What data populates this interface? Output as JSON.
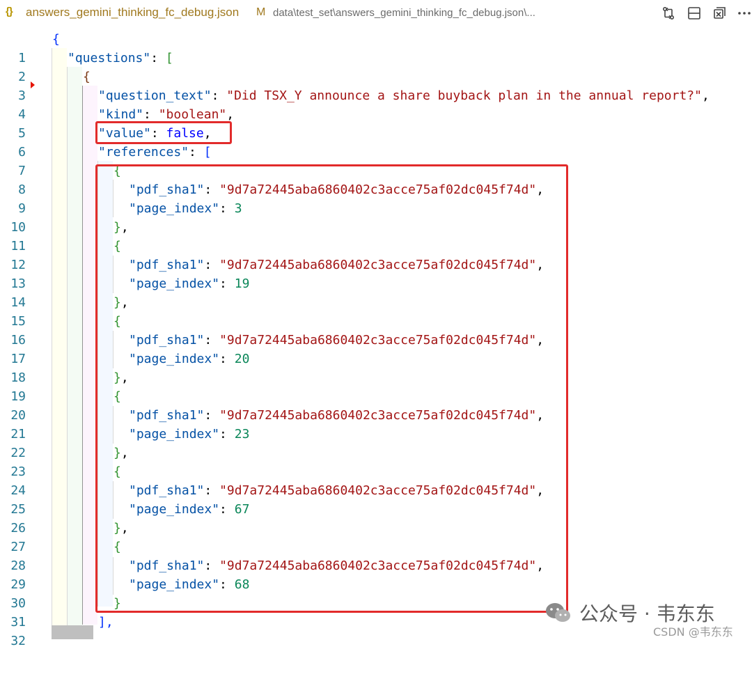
{
  "tab": {
    "icon_text": "{}",
    "file_name": "answers_gemini_thinking_fc_debug.json",
    "modified_flag": "M",
    "path": "data\\test_set\\answers_gemini_thinking_fc_debug.json\\..."
  },
  "toolbar": {
    "icons": [
      "source-control-compare-icon",
      "split-editor-icon",
      "collapse-all-icon",
      "more-actions-icon"
    ],
    "more_label": "···"
  },
  "editor": {
    "line_numbers": [
      "1",
      "2",
      "3",
      "4",
      "5",
      "6",
      "7",
      "8",
      "9",
      "10",
      "11",
      "12",
      "13",
      "14",
      "15",
      "16",
      "17",
      "18",
      "19",
      "20",
      "21",
      "22",
      "23",
      "24",
      "25",
      "26",
      "27",
      "28",
      "29",
      "30",
      "31",
      "32"
    ],
    "open_brace": "{",
    "questions_key": "\"questions\"",
    "open_bracket": "[",
    "question_text_key": "\"question_text\"",
    "question_text_value": "\"Did TSX_Y announce a share buyback plan in the annual report?\"",
    "kind_key": "\"kind\"",
    "kind_value": "\"boolean\"",
    "value_key": "\"value\"",
    "value_value": "false",
    "references_key": "\"references\"",
    "pdf_sha1_key": "\"pdf_sha1\"",
    "pdf_sha1_value": "\"9d7a72445aba6860402c3acce75af02dc045f74d\"",
    "page_index_key": "\"page_index\"",
    "references": [
      {
        "page_index": "3"
      },
      {
        "page_index": "19"
      },
      {
        "page_index": "20"
      },
      {
        "page_index": "23"
      },
      {
        "page_index": "67"
      },
      {
        "page_index": "68"
      }
    ],
    "close_bracket_comma": "],"
  },
  "watermark": {
    "text": "公众号 · 韦东东",
    "source": "CSDN @韦东东"
  },
  "colors": {
    "key": "#0451a5",
    "string": "#a31515",
    "number": "#098658",
    "boolean": "#0000ff",
    "line_number": "#237893",
    "highlight_box": "#e22b2b"
  }
}
